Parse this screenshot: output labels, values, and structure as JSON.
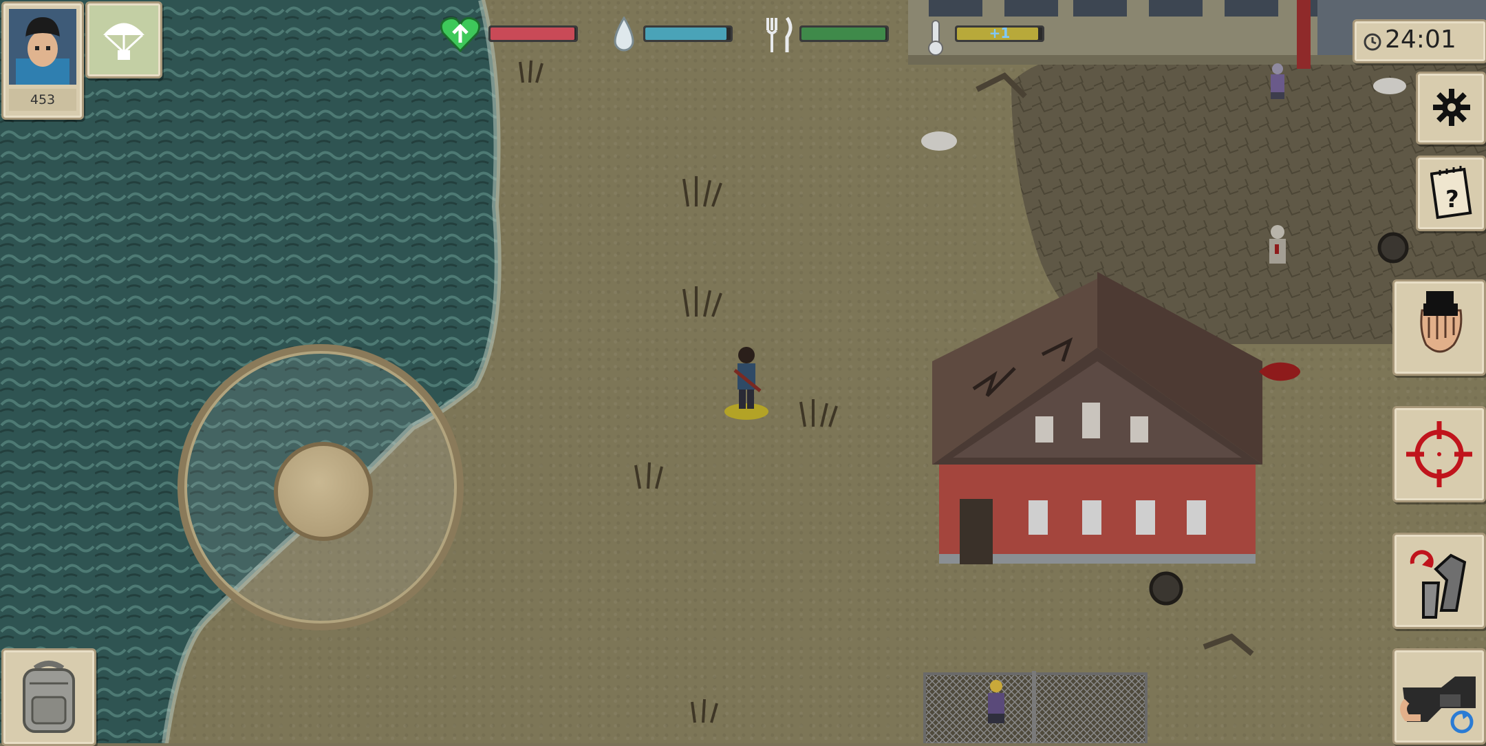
{
  "hud": {
    "player_score": "453",
    "clock": "24:01",
    "temperature_label": "+1",
    "health_level": 0.98,
    "thirst_level": 0.95,
    "hunger_level": 0.98,
    "temperature_level": 0.95
  },
  "colors": {
    "health": "#c94a57",
    "thirst": "#4aa3b8",
    "hunger": "#3f8a4a",
    "temperature": "#b8a93a",
    "panel_bg": "#d8ccae",
    "crosshair": "#c0141c"
  },
  "icons": {
    "avatar": "player-portrait-icon",
    "airdrop": "parachute-icon",
    "health": "heart-icon",
    "thirst": "water-drop-icon",
    "hunger": "fork-knife-icon",
    "temperature": "thermometer-icon",
    "clock": "clock-icon",
    "settings": "gear-icon",
    "quests": "notepad-icon",
    "interact": "hand-grab-icon",
    "attack": "crosshair-icon",
    "reload": "reload-weapon-icon",
    "camera": "camera-icon",
    "inventory": "backpack-icon"
  }
}
